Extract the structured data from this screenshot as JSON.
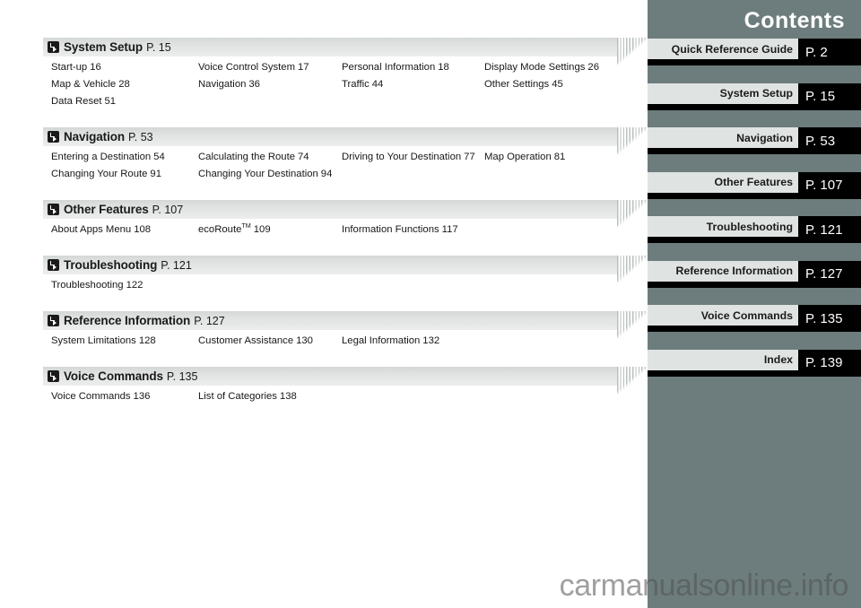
{
  "sidebar": {
    "title": "Contents",
    "bg_color": "#6d7d7d",
    "tabs": [
      {
        "label": "Quick Reference Guide",
        "page": "P. 2"
      },
      {
        "label": "System Setup",
        "page": "P. 15"
      },
      {
        "label": "Navigation",
        "page": "P. 53"
      },
      {
        "label": "Other Features",
        "page": "P. 107"
      },
      {
        "label": "Troubleshooting",
        "page": "P. 121"
      },
      {
        "label": "Reference Information",
        "page": "P. 127"
      },
      {
        "label": "Voice Commands",
        "page": "P. 135"
      },
      {
        "label": "Index",
        "page": "P. 139"
      }
    ]
  },
  "toc": {
    "sections": [
      {
        "icon": "arrow-jump-icon",
        "title": "System Setup",
        "page": "P. 15",
        "rows": [
          [
            {
              "label": "Start-up",
              "num": "16"
            },
            {
              "label": "Voice Control System",
              "num": "17"
            },
            {
              "label": "Personal Information",
              "num": "18"
            },
            {
              "label": "Display Mode Settings",
              "num": "26"
            }
          ],
          [
            {
              "label": "Map & Vehicle",
              "num": "28"
            },
            {
              "label": "Navigation",
              "num": "36"
            },
            {
              "label": "Traffic",
              "num": "44"
            },
            {
              "label": "Other Settings",
              "num": "45"
            }
          ],
          [
            {
              "label": "Data Reset",
              "num": "51"
            }
          ]
        ]
      },
      {
        "icon": "arrow-jump-icon",
        "title": "Navigation",
        "page": "P. 53",
        "rows": [
          [
            {
              "label": "Entering a Destination",
              "num": "54"
            },
            {
              "label": "Calculating the Route",
              "num": "74"
            },
            {
              "label": "Driving to Your Destination",
              "num": "77"
            },
            {
              "label": "Map Operation",
              "num": "81"
            }
          ],
          [
            {
              "label": "Changing Your Route",
              "num": "91"
            },
            {
              "label": "Changing Your Destination",
              "num": "94"
            }
          ]
        ]
      },
      {
        "icon": "arrow-jump-icon",
        "title": "Other Features",
        "page": "P. 107",
        "rows": [
          [
            {
              "label": "About Apps Menu",
              "num": "108"
            },
            {
              "label": "ecoRoute",
              "sup": "TM",
              "num": "109"
            },
            {
              "label": "Information Functions",
              "num": "117"
            }
          ]
        ]
      },
      {
        "icon": "arrow-jump-icon",
        "title": "Troubleshooting",
        "page": "P. 121",
        "rows": [
          [
            {
              "label": "Troubleshooting",
              "num": "122"
            }
          ]
        ]
      },
      {
        "icon": "arrow-jump-icon",
        "title": "Reference Information",
        "page": "P. 127",
        "rows": [
          [
            {
              "label": "System Limitations",
              "num": "128"
            },
            {
              "label": "Customer Assistance",
              "num": "130"
            },
            {
              "label": "Legal Information",
              "num": "132"
            }
          ]
        ]
      },
      {
        "icon": "arrow-jump-icon",
        "title": "Voice Commands",
        "page": "P. 135",
        "rows": [
          [
            {
              "label": "Voice Commands",
              "num": "136"
            },
            {
              "label": "List of Categories",
              "num": "138"
            }
          ]
        ]
      }
    ]
  },
  "watermark": {
    "text": "carmanualsonline.info"
  }
}
